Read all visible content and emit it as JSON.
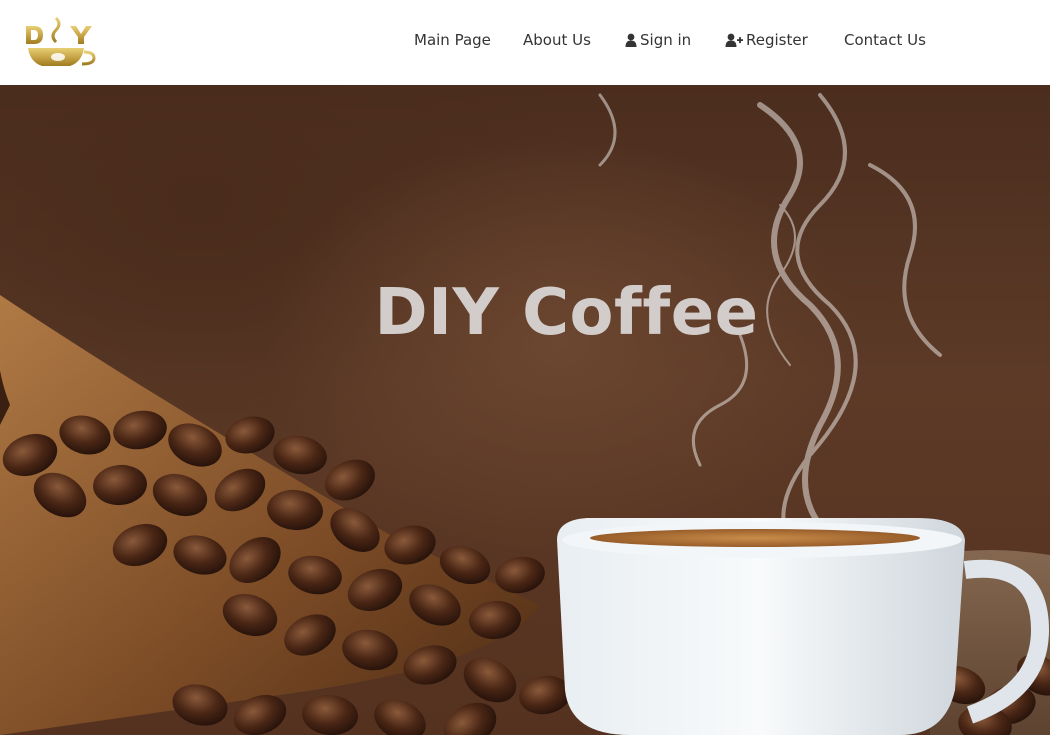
{
  "brand": {
    "logo_text": "DIY"
  },
  "nav": {
    "items": [
      {
        "label": "Main Page",
        "icon": ""
      },
      {
        "label": "About Us",
        "icon": ""
      },
      {
        "label": "Sign in",
        "icon": "user-icon"
      },
      {
        "label": "Register",
        "icon": "user-plus-icon"
      },
      {
        "label": "Contact Us",
        "icon": ""
      }
    ]
  },
  "hero": {
    "title": "DIY Coffee"
  },
  "colors": {
    "background": "#ffffff",
    "nav_text": "#343434",
    "hero_title": "#d2cdca",
    "logo_gold": "#c8a548"
  }
}
